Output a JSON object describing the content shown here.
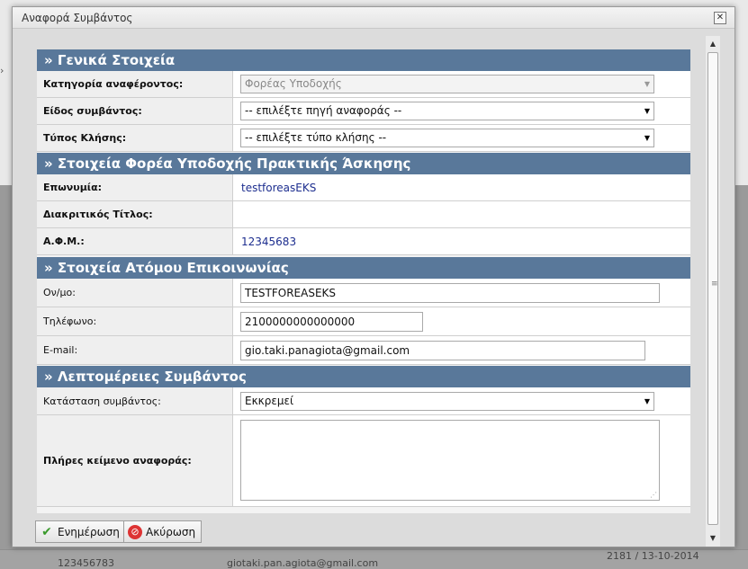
{
  "background": {
    "bottom_left_text": "123456783",
    "bottom_mid_text": "giotaki.pan.agiota@gmail.com",
    "bottom_right_text": "2181 / 13-10-2014"
  },
  "dialog": {
    "title": "Αναφορά Συμβάντος",
    "close_glyph": "✕"
  },
  "sections": {
    "general": {
      "title": "» Γενικά Στοιχεία",
      "reporter_category_label": "Κατηγορία αναφέροντος:",
      "reporter_category_value": "Φορέας Υποδοχής",
      "incident_type_label": "Είδος συμβάντος:",
      "incident_type_value": "-- επιλέξτε πηγή αναφοράς --",
      "call_type_label": "Τύπος Κλήσης:",
      "call_type_value": "-- επιλέξτε τύπο κλήσης --"
    },
    "host": {
      "title": "» Στοιχεία Φορέα Υποδοχής Πρακτικής Άσκησης",
      "name_label": "Επωνυμία:",
      "name_value": "testforeasEKS",
      "distinctive_title_label": "Διακριτικός Τίτλος:",
      "distinctive_title_value": "",
      "afm_label": "Α.Φ.Μ.:",
      "afm_value": "12345683"
    },
    "contact": {
      "title": "» Στοιχεία Ατόμου Επικοινωνίας",
      "name_label": "Ον/μο:",
      "name_value": "TESTFOREASEKS",
      "phone_label": "Τηλέφωνο:",
      "phone_value": "2100000000000000",
      "email_label": "E-mail:",
      "email_value": "gio.taki.panagiota@gmail.com"
    },
    "details": {
      "title": "» Λεπτομέρειες Συμβάντος",
      "status_label": "Κατάσταση συμβάντος:",
      "status_value": "Εκκρεμεί",
      "full_text_label": "Πλήρες κείμενο αναφοράς:",
      "full_text_value": ""
    }
  },
  "buttons": {
    "update_label": "Ενημέρωση",
    "cancel_label": "Ακύρωση"
  },
  "icons": {
    "dropdown": "chevron-down-icon",
    "update": "check-icon",
    "cancel": "cancel-icon",
    "close": "close-icon"
  },
  "colors": {
    "section_header": "#59789a",
    "link_value": "#1d2e8f"
  }
}
